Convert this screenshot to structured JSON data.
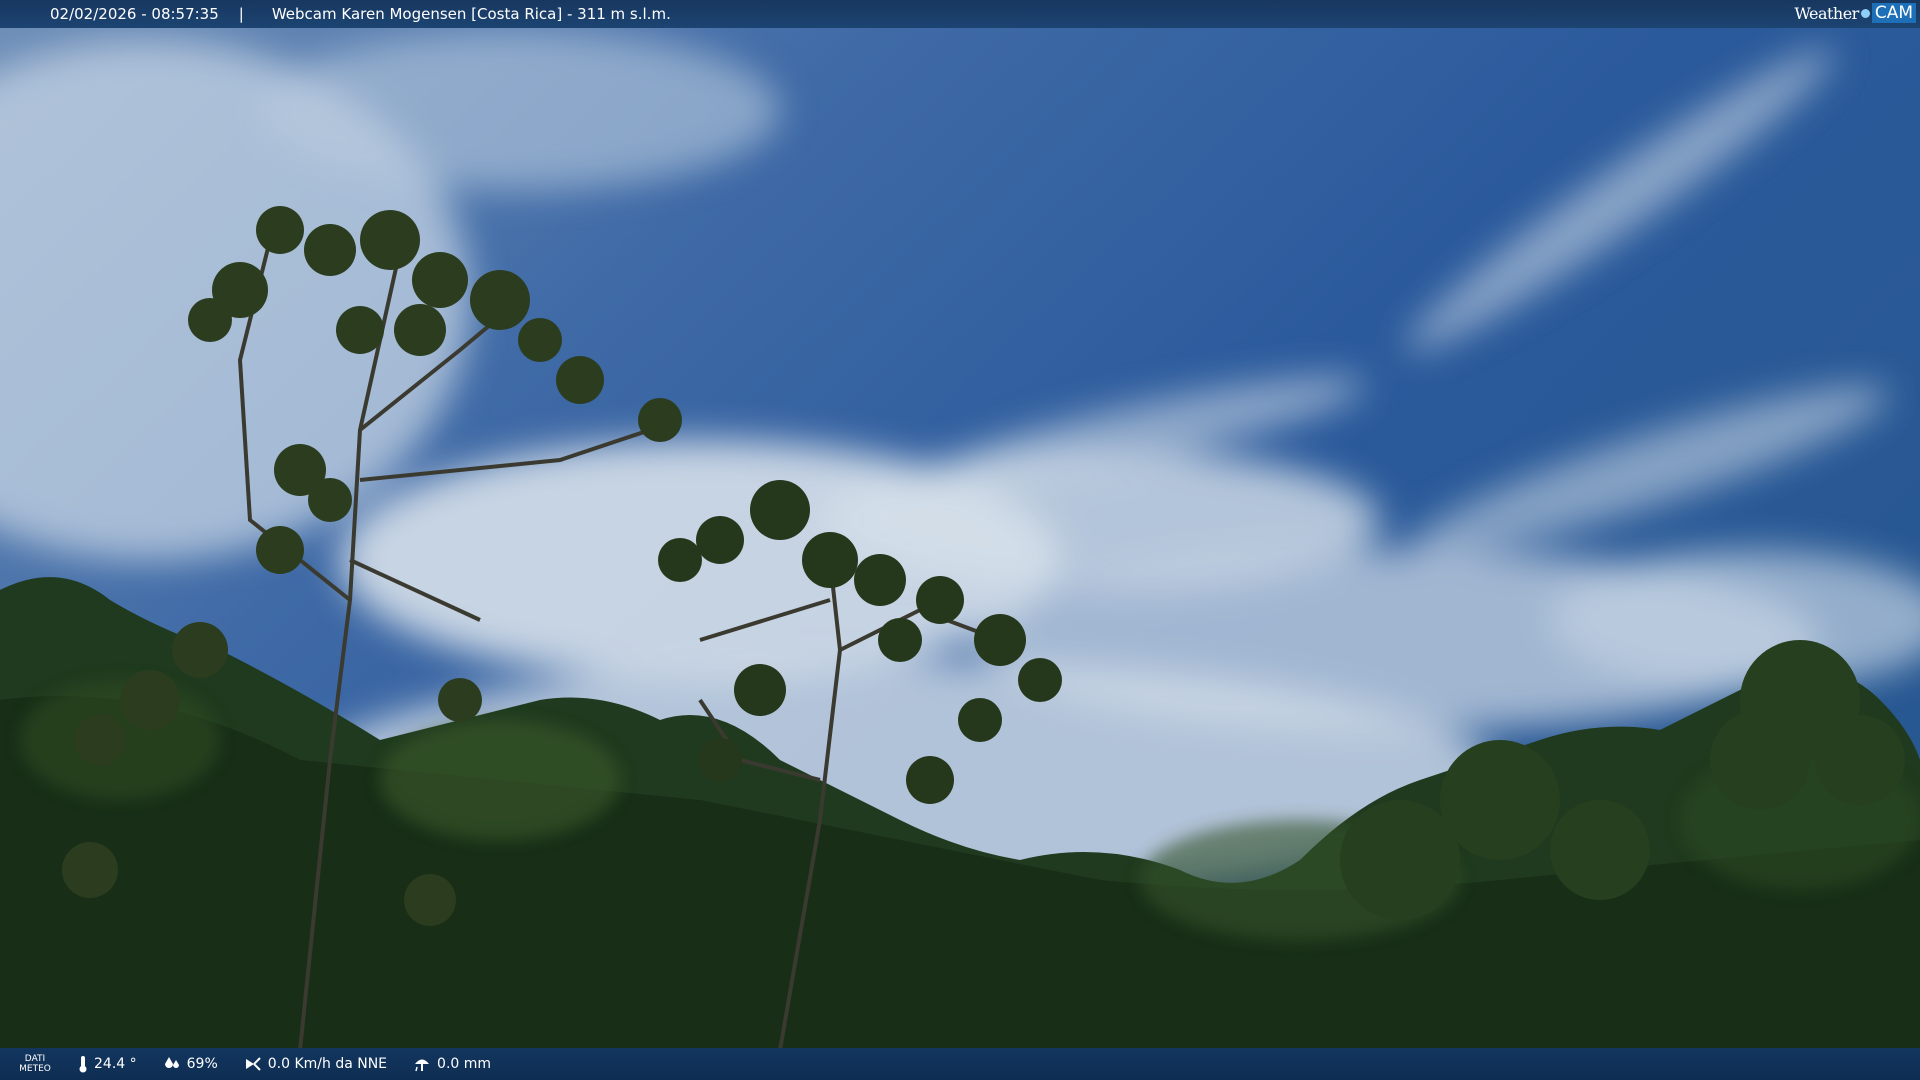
{
  "header": {
    "timestamp": "02/02/2026 - 08:57:35",
    "separator": "|",
    "location": "Webcam Karen Mogensen [Costa Rica]  - 311 m s.l.m.",
    "logo_left": "Weather",
    "logo_right": "CAM"
  },
  "footer": {
    "label_line1": "DATI",
    "label_line2": "METEO",
    "temperature": "24.4 °",
    "humidity": "69%",
    "wind": "0.0 Km/h da NNE",
    "rain": "0.0 mm"
  },
  "colors": {
    "sky": "#2f63a8",
    "foliage": "#1f3a1e",
    "bar": "#17375f"
  },
  "icons": [
    "thermometer-icon",
    "humidity-icon",
    "wind-icon",
    "rain-icon"
  ]
}
